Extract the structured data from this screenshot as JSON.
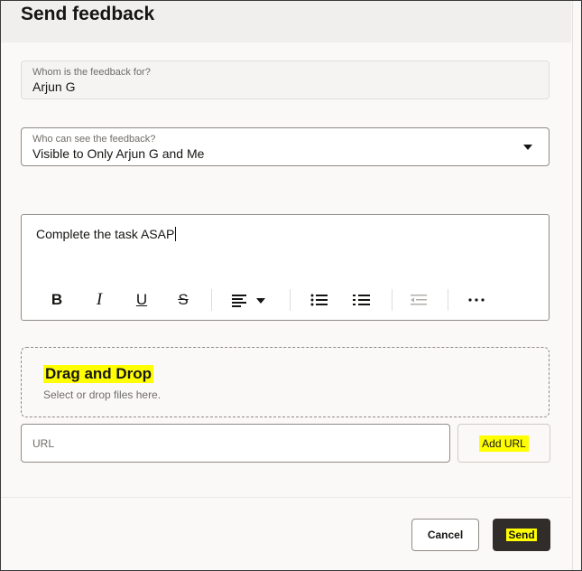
{
  "dialog": {
    "title": "Send feedback"
  },
  "recipient": {
    "label": "Whom is the feedback for?",
    "value": "Arjun G"
  },
  "visibility": {
    "label": "Who can see the feedback?",
    "value": "Visible to Only Arjun G and Me"
  },
  "editor": {
    "content": "Complete the task ASAP",
    "toolbar": {
      "bold": "B",
      "italic": "I",
      "underline": "U",
      "strikethrough": "S",
      "icons": [
        "align-left-icon",
        "chevron-down-icon",
        "bullet-list-icon",
        "numbered-list-icon",
        "outdent-icon",
        "more-icon"
      ]
    }
  },
  "upload": {
    "title": "Drag and Drop",
    "subtitle": "Select or drop files here."
  },
  "url": {
    "placeholder": "URL",
    "add_label": "Add URL"
  },
  "footer": {
    "cancel_label": "Cancel",
    "send_label": "Send"
  },
  "colors": {
    "highlight": "#ffff00",
    "primary_button": "#312d2a",
    "border": "#8f8b86"
  }
}
